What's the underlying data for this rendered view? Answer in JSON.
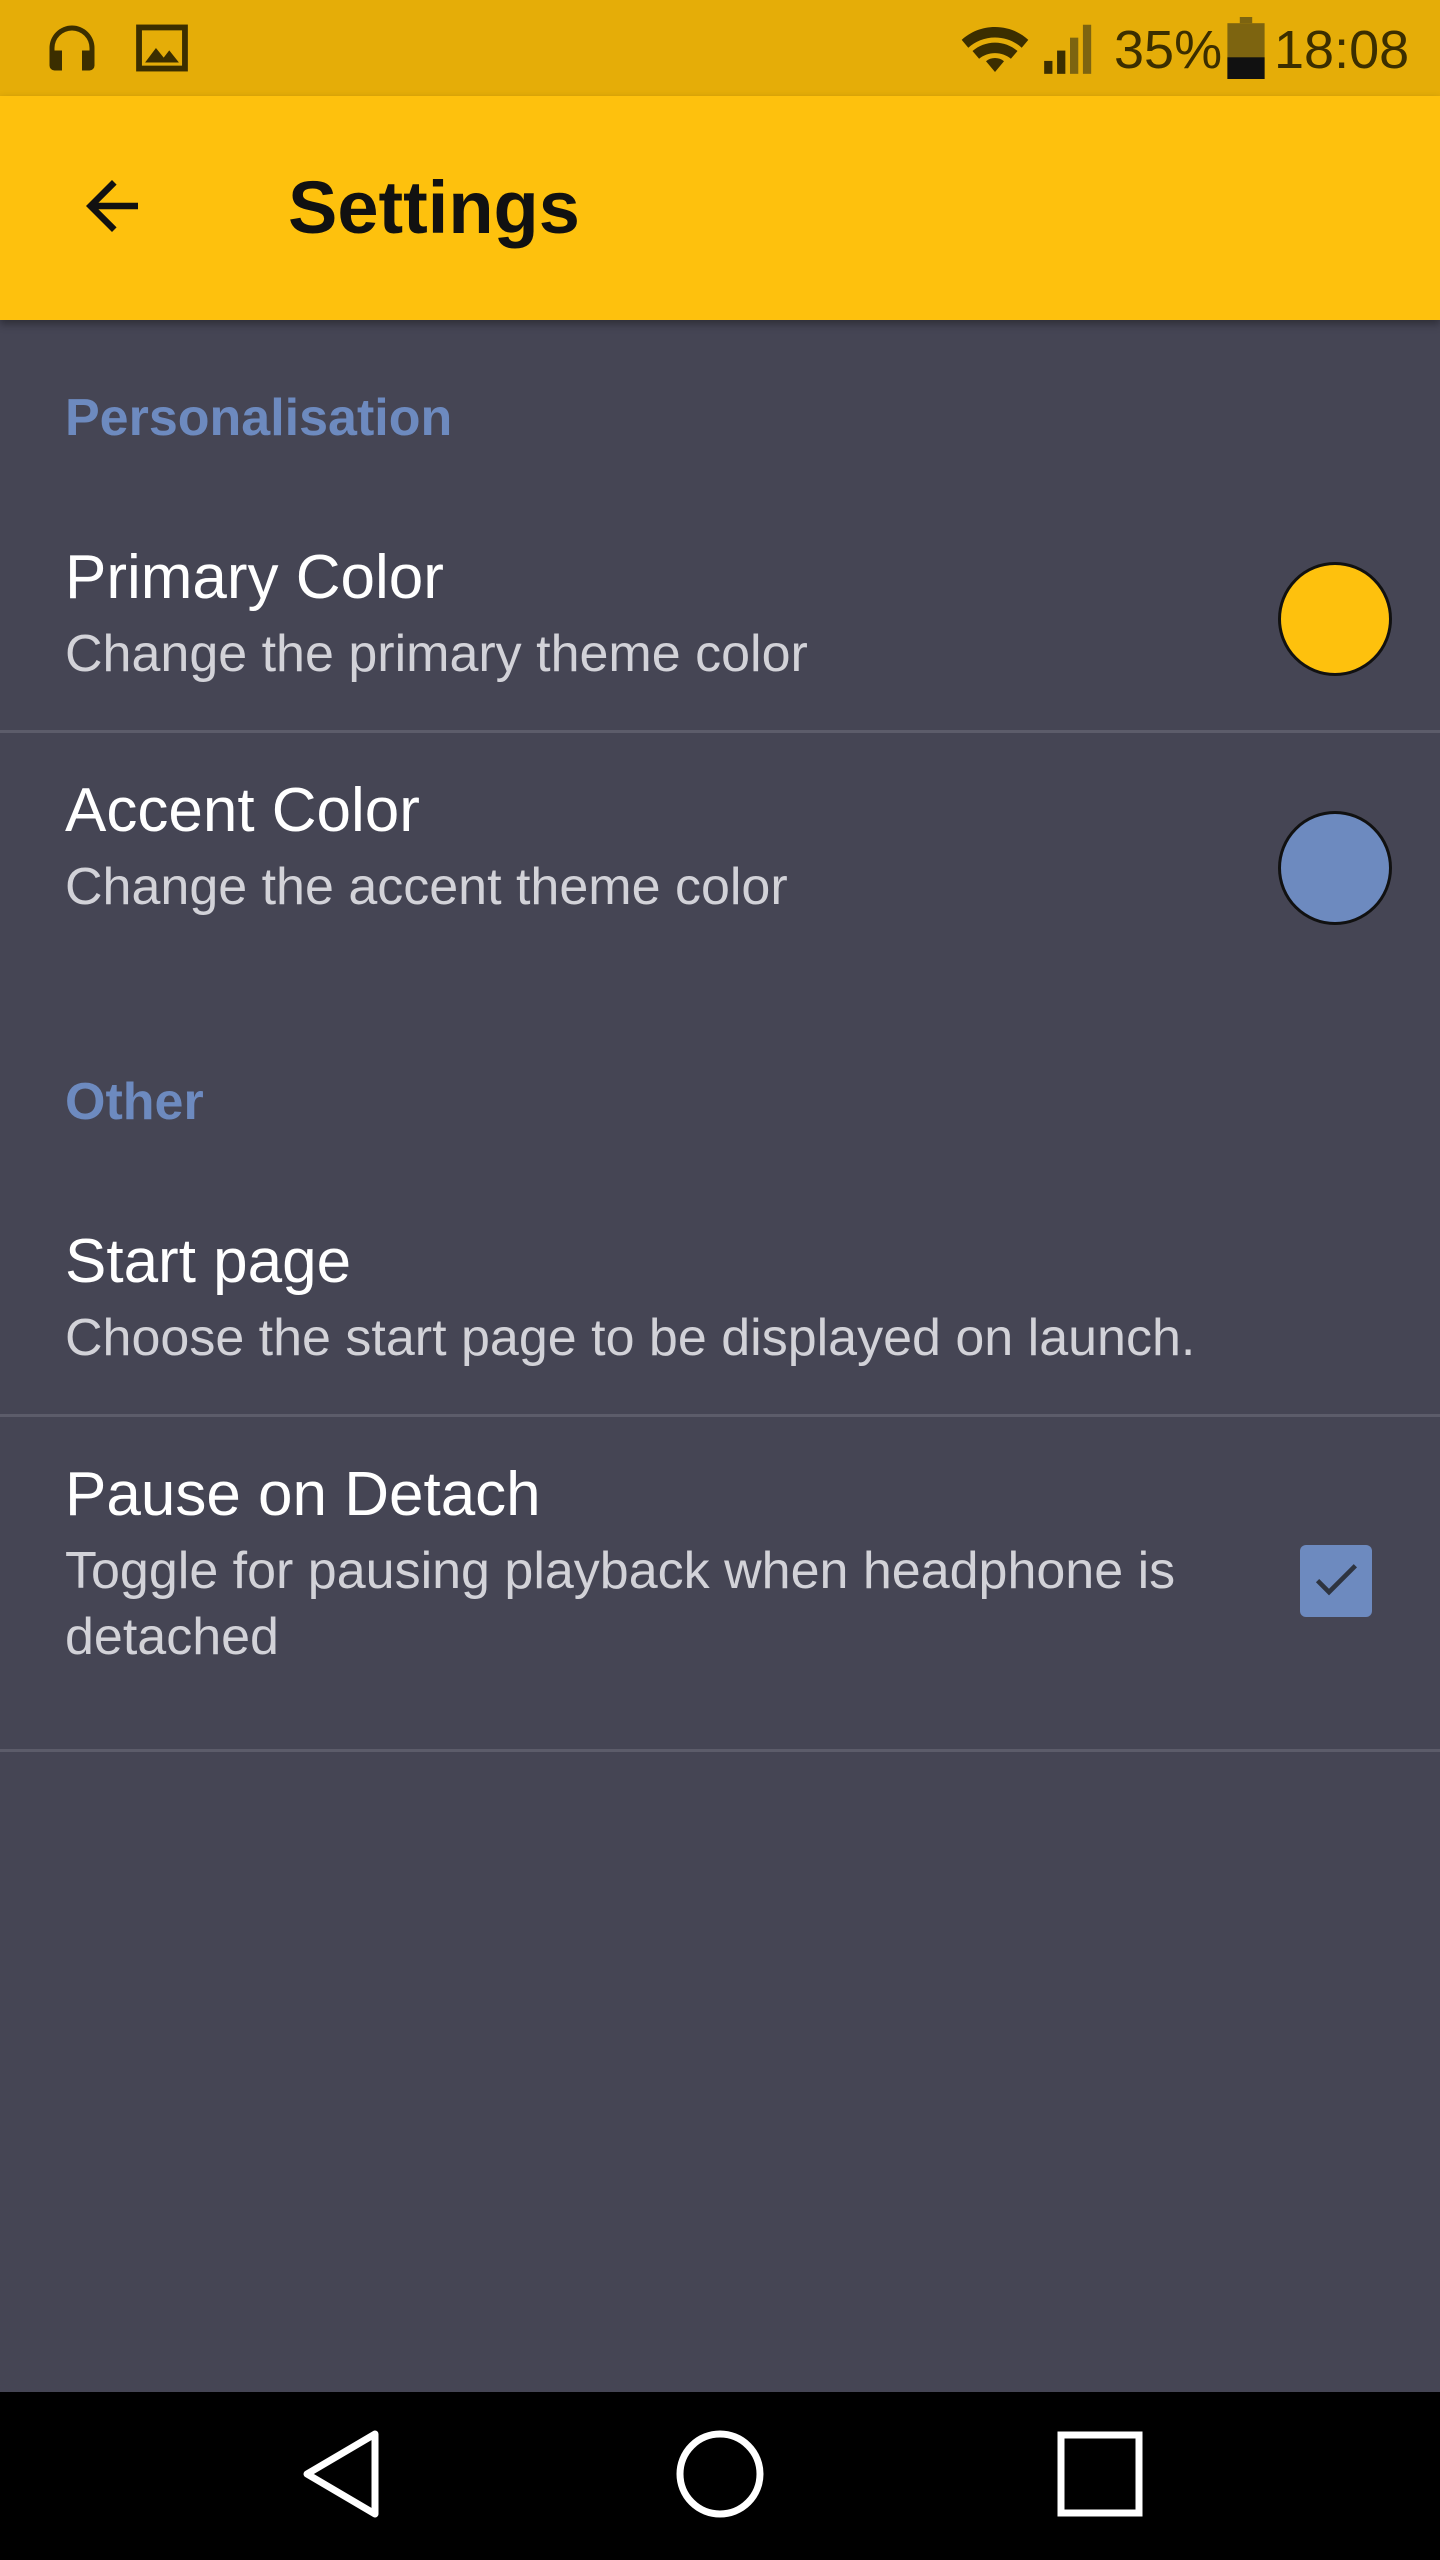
{
  "status_bar": {
    "battery_percent": "35%",
    "time": "18:08",
    "icons": [
      "headphones-icon",
      "image-icon",
      "wifi-icon",
      "signal-icon",
      "battery-icon"
    ]
  },
  "toolbar": {
    "title": "Settings",
    "back_icon": "arrow-left-icon"
  },
  "sections": [
    {
      "header": "Personalisation",
      "items": [
        {
          "title": "Primary Color",
          "summary": "Change the primary theme color",
          "widget": "color-swatch",
          "color": "#FEC10D"
        },
        {
          "title": "Accent Color",
          "summary": "Change the accent theme color",
          "widget": "color-swatch",
          "color": "#6D8ABF"
        }
      ]
    },
    {
      "header": "Other",
      "items": [
        {
          "title": "Start page",
          "summary": "Choose the start page to be displayed on launch."
        },
        {
          "title": "Pause on Detach",
          "summary": "Toggle for pausing playback when headphone is detached",
          "widget": "checkbox",
          "checked": true
        }
      ]
    }
  ],
  "colors": {
    "status_bar": "#E5AD08",
    "toolbar": "#FEC10D",
    "background": "#454554",
    "accent": "#6D8ABF",
    "nav_bar": "#000000"
  },
  "nav_bar": {
    "buttons": [
      "back-triangle-icon",
      "home-circle-icon",
      "recents-square-icon"
    ]
  }
}
